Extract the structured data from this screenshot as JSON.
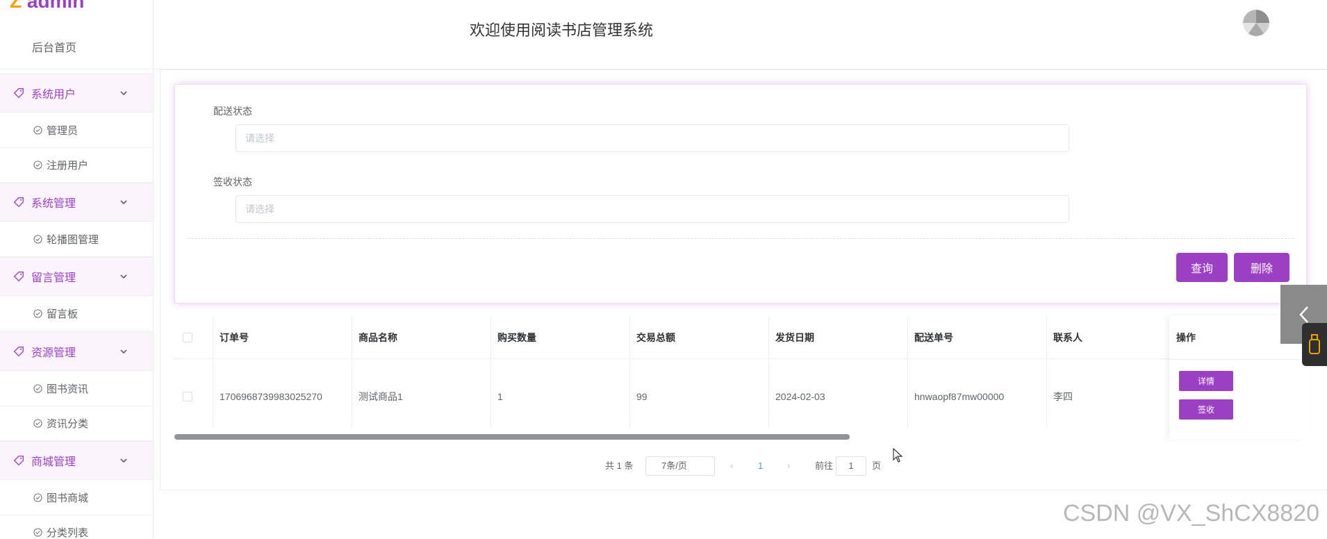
{
  "sidebar": {
    "logo_text": "admin",
    "home_label": "后台首页",
    "groups": [
      {
        "label": "系统用户",
        "items": [
          "管理员",
          "注册用户"
        ]
      },
      {
        "label": "系统管理",
        "items": [
          "轮播图管理"
        ]
      },
      {
        "label": "留言管理",
        "items": [
          "留言板"
        ]
      },
      {
        "label": "资源管理",
        "items": [
          "图书资讯",
          "资讯分类"
        ]
      },
      {
        "label": "商城管理",
        "items": [
          "图书商城",
          "分类列表"
        ]
      }
    ]
  },
  "header": {
    "title": "欢迎使用阅读书店管理系统"
  },
  "search": {
    "delivery_status": {
      "label": "配送状态",
      "placeholder": "请选择"
    },
    "receipt_status": {
      "label": "签收状态",
      "placeholder": "请选择"
    },
    "query_label": "查询",
    "delete_label": "删除"
  },
  "table": {
    "columns": [
      "订单号",
      "商品名称",
      "购买数量",
      "交易总额",
      "发货日期",
      "配送单号",
      "联系人",
      "操作"
    ],
    "rows": [
      {
        "order_no": "1706968739983025270",
        "product": "测试商品1",
        "quantity": "1",
        "total": "99",
        "ship_date": "2024-02-03",
        "delivery_no": "hnwaopf87mw00000",
        "contact": "李四",
        "detail_label": "详情",
        "sign_label": "签收"
      }
    ]
  },
  "pagination": {
    "total_text": "共 1 条",
    "page_size": "7条/页",
    "current_page": "1",
    "goto_label": "前往",
    "goto_value": "1",
    "page_suffix": "页"
  },
  "watermark": "CSDN @VX_ShCX8820",
  "colors": {
    "accent": "#9b3fc4",
    "accent_light_bg": "#fbf4fc",
    "logo_z": "#f2a100"
  }
}
